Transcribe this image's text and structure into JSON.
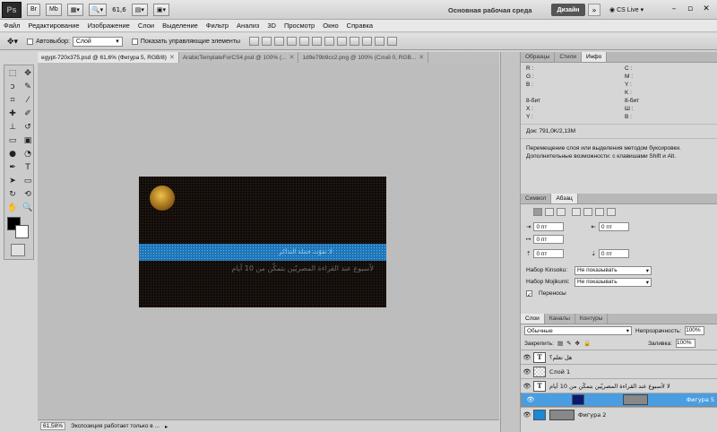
{
  "topbar": {
    "logo": "Ps",
    "btn_br": "Br",
    "btn_mb": "Mb",
    "zoom": "61,6",
    "workspace": "Основная рабочая среда",
    "design": "Дизайн",
    "more": "»",
    "cslive": "CS Live"
  },
  "menu": [
    "Файл",
    "Редактирование",
    "Изображение",
    "Слои",
    "Выделение",
    "Фильтр",
    "Анализ",
    "3D",
    "Просмотр",
    "Окно",
    "Справка"
  ],
  "options": {
    "autoselect": "Автовыбор:",
    "autoselect_value": "Слой",
    "show_controls": "Показать управляющие элементы"
  },
  "doc_tabs": [
    {
      "label": "egypt-720x375.psd @ 61,6% (Фигура 5, RGB/8)"
    },
    {
      "label": "ArabicTemplateForCS4.psd @ 100% (..."
    },
    {
      "label": "1d9e79b9cc2.png @ 100% (Слой 0, RGB..."
    }
  ],
  "artwork": {
    "headline": "لا تفوّت حملة التذاكر",
    "body": "لأسبوع عند القراءة المصريّين بتمكّن من 10 أيام"
  },
  "status": {
    "zoom": "61,58%",
    "text": "Экспозиция работает только в ..."
  },
  "info_panel": {
    "tabs": [
      "Образцы",
      "Стили",
      "Инфо"
    ],
    "left": [
      "R :",
      "G :",
      "B :",
      "8-бит",
      "X :",
      "Y :"
    ],
    "right": [
      "C :",
      "M :",
      "Y :",
      "K :",
      "8-бит",
      "Ш :",
      "В :"
    ],
    "doc": "Док: 791,0K/2,13M",
    "hint": "Перемещение слоя или выделения методом буксировки. Дополнительные возможности: с клавишами Shift и Alt."
  },
  "para_panel": {
    "tabs": [
      "Символ",
      "Абзац"
    ],
    "fields": [
      "0 пт",
      "0 пт",
      "0 пт",
      "0 пт",
      "0 пт"
    ],
    "kinsoku_label": "Набор Kinsoku:",
    "kinsoku_value": "Не показывать",
    "mojikumi_label": "Набор Mojikumi:",
    "mojikumi_value": "Не показывать",
    "hyphen": "Переносы"
  },
  "layers_panel": {
    "tabs": [
      "Слои",
      "Каналы",
      "Контуры"
    ],
    "blend": "Обычные",
    "opacity_label": "Непрозрачность:",
    "opacity": "100%",
    "lock_label": "Закрепить:",
    "fill_label": "Заливка:",
    "fill": "100%",
    "layers": [
      {
        "name": "هل تعلم؟",
        "type": "text"
      },
      {
        "name": "Слой 1",
        "type": "checker"
      },
      {
        "name": "لا لأسبوع عند القراءة المصريّين بتمكّن من 10 أيام",
        "type": "text"
      },
      {
        "name": "Фигура 5",
        "type": "navy",
        "selected": true
      },
      {
        "name": "Фигура 2",
        "type": "blue"
      }
    ]
  }
}
